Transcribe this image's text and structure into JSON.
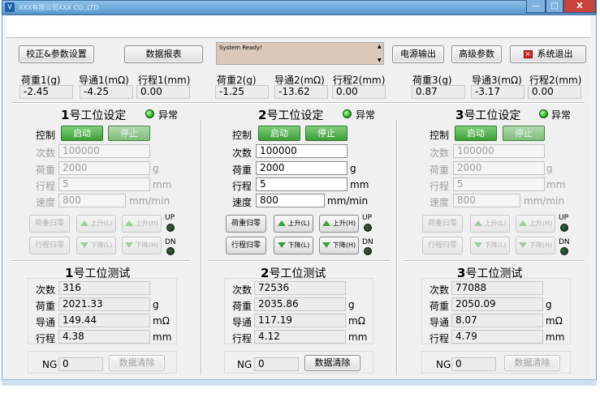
{
  "window": {
    "title": "XXX有限公司XXX CO.,LTD",
    "min": "—",
    "max": "□",
    "close": "X"
  },
  "toolbar": {
    "calibrate": "校正&参数设置",
    "report": "数据报表",
    "status": "System Ready!",
    "power_out": "电源输出",
    "advanced": "高级参数",
    "exit": "系统退出"
  },
  "readouts": [
    {
      "l1": "荷重1(g)",
      "v1": "-2.45",
      "l2": "导通1(mΩ)",
      "v2": "-4.25",
      "l3": "行程1(mm)",
      "v3": "0.00"
    },
    {
      "l1": "荷重2(g)",
      "v1": "-1.25",
      "l2": "导通2(mΩ)",
      "v2": "-13.62",
      "l3": "行程2(mm)",
      "v3": "0.00"
    },
    {
      "l1": "荷重3(g)",
      "v1": "0.87",
      "l2": "导通3(mΩ)",
      "v2": "-3.17",
      "l3": "行程2(mm)",
      "v3": "0.00"
    }
  ],
  "labels": {
    "control": "控制",
    "count": "次数",
    "load": "荷重",
    "stroke": "行程",
    "speed": "速度",
    "conduct": "导通",
    "start": "启动",
    "stop": "停止",
    "unit_g": "g",
    "unit_mm": "mm",
    "unit_speed": "mm/min",
    "unit_mohm": "mΩ",
    "abnormal": "异常",
    "load_zero": "荷重归零",
    "stroke_zero": "行程归零",
    "up_l": "上升(L)",
    "up_h": "上升(H)",
    "down_l": "下降(L)",
    "down_h": "下降(H)",
    "up": "UP",
    "dn": "DN",
    "ng": "NG",
    "clear": "数据清除"
  },
  "stations": [
    {
      "set_title_num": "1",
      "set_title": "号工位设定",
      "test_title_num": "1",
      "test_title": "号工位测试",
      "count": "100000",
      "load": "2000",
      "stroke": "5",
      "speed": "800",
      "t_count": "316",
      "t_load": "2021.33",
      "t_conduct": "149.44",
      "t_stroke": "4.38",
      "ng": "0"
    },
    {
      "set_title_num": "2",
      "set_title": "号工位设定",
      "test_title_num": "2",
      "test_title": "号工位测试",
      "count": "100000",
      "load": "2000",
      "stroke": "5",
      "speed": "800",
      "t_count": "72536",
      "t_load": "2035.86",
      "t_conduct": "117.19",
      "t_stroke": "4.12",
      "ng": "0"
    },
    {
      "set_title_num": "3",
      "set_title": "号工位设定",
      "test_title_num": "3",
      "test_title": "号工位测试",
      "count": "100000",
      "load": "2000",
      "stroke": "5",
      "speed": "800",
      "t_count": "77088",
      "t_load": "2050.09",
      "t_conduct": "8.07",
      "t_stroke": "4.79",
      "ng": "0"
    }
  ],
  "colors": {
    "accent_green": "#3e9e39",
    "status_bg": "#dcc8b8",
    "exit_red": "#d6282b"
  }
}
